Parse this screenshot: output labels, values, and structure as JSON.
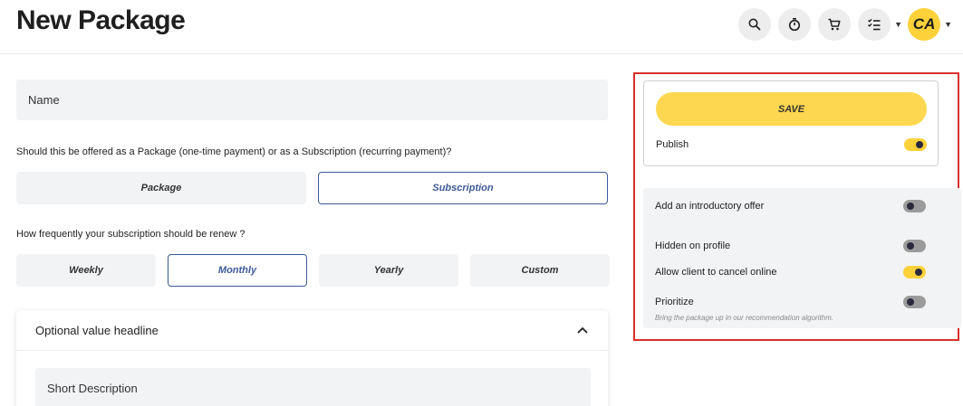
{
  "header": {
    "title": "New Package",
    "icons": [
      "search-icon",
      "timer-icon",
      "cart-icon",
      "checklist-icon"
    ],
    "avatar_initials": "CA"
  },
  "form": {
    "name_placeholder": "Name",
    "type_question": "Should this be offered as a Package (one-time payment) or as a Subscription (recurring payment)?",
    "type_options": [
      "Package",
      "Subscription"
    ],
    "type_selected": "Subscription",
    "frequency_question": "How frequently your subscription should be renew ?",
    "frequency_options": [
      "Weekly",
      "Monthly",
      "Yearly",
      "Custom"
    ],
    "frequency_selected": "Monthly",
    "optional_card": {
      "title": "Optional value headline",
      "short_description_placeholder": "Short Description"
    }
  },
  "sidebar": {
    "save_label": "SAVE",
    "publish": {
      "label": "Publish",
      "on": true
    },
    "settings": [
      {
        "label": "Add an introductory offer",
        "on": false
      },
      {
        "label": "Hidden on profile",
        "on": false
      },
      {
        "label": "Allow client to cancel online",
        "on": true
      },
      {
        "label": "Prioritize",
        "on": false,
        "hint": "Bring the package up in our recommendation algorithm."
      }
    ]
  },
  "colors": {
    "accent_yellow": "#fdd13a",
    "selected_blue": "#3d5a98",
    "highlight_red": "#d9302c",
    "field_gray": "#f2f3f5"
  }
}
